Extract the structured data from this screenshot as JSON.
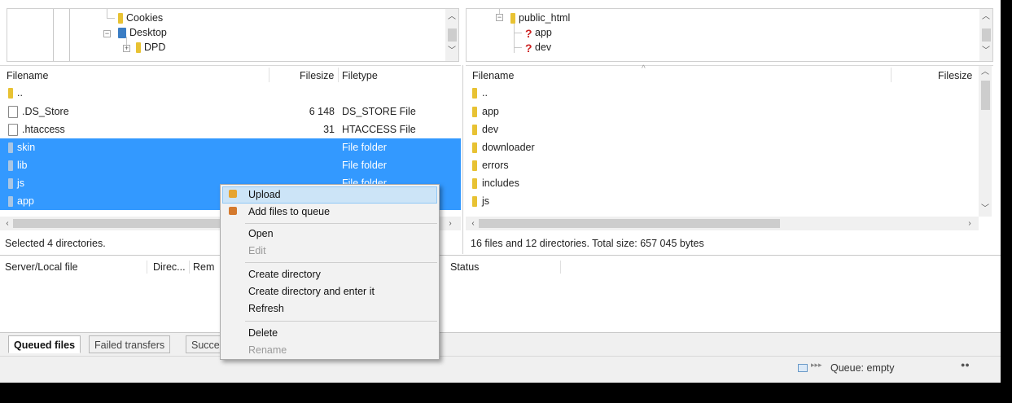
{
  "local_tree": {
    "items": [
      {
        "label": "Cookies",
        "icon": "folder-icon"
      },
      {
        "label": "Desktop",
        "icon": "folder-icon"
      },
      {
        "label": "DPD",
        "icon": "folder-icon"
      }
    ]
  },
  "remote_tree": {
    "items": [
      {
        "label": "public_html",
        "icon": "folder-icon"
      },
      {
        "label": "app",
        "icon": "unknown-folder-icon"
      },
      {
        "label": "dev",
        "icon": "unknown-folder-icon"
      }
    ]
  },
  "local_list": {
    "columns": {
      "filename": "Filename",
      "filesize": "Filesize",
      "filetype": "Filetype"
    },
    "rows": [
      {
        "name": "..",
        "size": "",
        "type": "",
        "icon": "folder-icon",
        "selected": false
      },
      {
        "name": ".DS_Store",
        "size": "6 148",
        "type": "DS_STORE File",
        "icon": "file-icon",
        "selected": false
      },
      {
        "name": ".htaccess",
        "size": "31",
        "type": "HTACCESS File",
        "icon": "file-icon",
        "selected": false
      },
      {
        "name": "skin",
        "size": "",
        "type": "File folder",
        "icon": "folder-icon",
        "selected": true
      },
      {
        "name": "lib",
        "size": "",
        "type": "File folder",
        "icon": "folder-icon",
        "selected": true
      },
      {
        "name": "js",
        "size": "",
        "type": "File folder",
        "icon": "folder-icon",
        "selected": true
      },
      {
        "name": "app",
        "size": "",
        "type": "",
        "icon": "folder-icon",
        "selected": true
      }
    ],
    "status": "Selected 4 directories."
  },
  "remote_list": {
    "columns": {
      "filename": "Filename",
      "filesize": "Filesize"
    },
    "rows": [
      {
        "name": "..",
        "icon": "folder-icon"
      },
      {
        "name": "app",
        "icon": "folder-icon"
      },
      {
        "name": "dev",
        "icon": "folder-icon"
      },
      {
        "name": "downloader",
        "icon": "folder-icon"
      },
      {
        "name": "errors",
        "icon": "folder-icon"
      },
      {
        "name": "includes",
        "icon": "folder-icon"
      },
      {
        "name": "js",
        "icon": "folder-icon"
      }
    ],
    "status": "16 files and 12 directories. Total size: 657 045 bytes"
  },
  "queue": {
    "columns": {
      "server_local_file": "Server/Local file",
      "direction": "Direc...",
      "remote": "Rem",
      "status": "Status"
    },
    "tabs": [
      "Queued files",
      "Failed transfers",
      "Succe"
    ],
    "indicator": "Queue: empty"
  },
  "context_menu": {
    "items": [
      {
        "label": "Upload",
        "icon": "upload-icon",
        "enabled": true,
        "highlighted": true
      },
      {
        "label": "Add files to queue",
        "icon": "add-to-queue-icon",
        "enabled": true
      },
      {
        "label": "Open",
        "enabled": true
      },
      {
        "label": "Edit",
        "enabled": false
      },
      {
        "label": "Create directory",
        "enabled": true
      },
      {
        "label": "Create directory and enter it",
        "enabled": true
      },
      {
        "label": "Refresh",
        "enabled": true
      },
      {
        "label": "Delete",
        "enabled": true
      },
      {
        "label": "Rename",
        "enabled": false
      }
    ]
  },
  "colors": {
    "selection": "#3399ff",
    "menu_highlight": "#cce4f7",
    "folder": "#e8c233"
  }
}
